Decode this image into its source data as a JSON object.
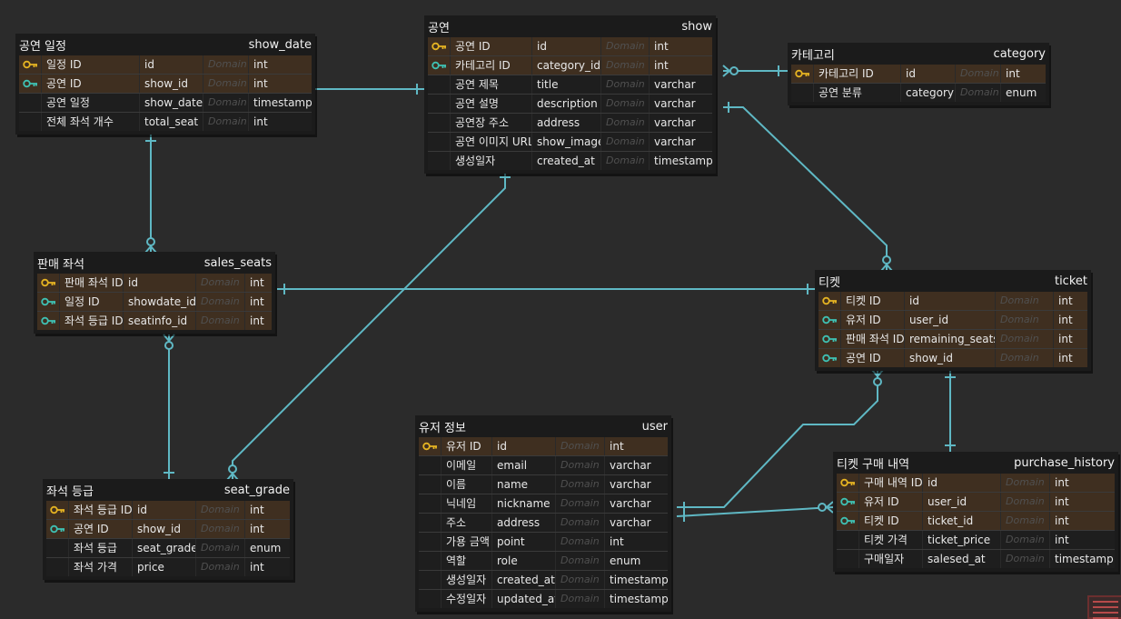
{
  "tables": {
    "show_date": {
      "title_ko": "공연 일정",
      "title_en": "show_date",
      "rows": [
        {
          "key": "pk",
          "label": "일정 ID",
          "col": "id",
          "domain": "Domain",
          "type": "int"
        },
        {
          "key": "fk",
          "label": "공연 ID",
          "col": "show_id",
          "domain": "Domain",
          "type": "int"
        },
        {
          "key": "",
          "label": "공연 일정",
          "col": "show_date",
          "domain": "Domain",
          "type": "timestamp"
        },
        {
          "key": "",
          "label": "전체 좌석 개수",
          "col": "total_seat",
          "domain": "Domain",
          "type": "int"
        }
      ]
    },
    "show": {
      "title_ko": "공연",
      "title_en": "show",
      "rows": [
        {
          "key": "pk",
          "label": "공연 ID",
          "col": "id",
          "domain": "Domain",
          "type": "int"
        },
        {
          "key": "fk",
          "label": "카테고리 ID",
          "col": "category_id",
          "domain": "Domain",
          "type": "int"
        },
        {
          "key": "",
          "label": "공연 제목",
          "col": "title",
          "domain": "Domain",
          "type": "varchar"
        },
        {
          "key": "",
          "label": "공연 설명",
          "col": "description",
          "domain": "Domain",
          "type": "varchar"
        },
        {
          "key": "",
          "label": "공연장 주소",
          "col": "address",
          "domain": "Domain",
          "type": "varchar"
        },
        {
          "key": "",
          "label": "공연 이미지 URL",
          "col": "show_image",
          "domain": "Domain",
          "type": "varchar"
        },
        {
          "key": "",
          "label": "생성일자",
          "col": "created_at",
          "domain": "Domain",
          "type": "timestamp"
        }
      ]
    },
    "category": {
      "title_ko": "카테고리",
      "title_en": "category",
      "rows": [
        {
          "key": "pk",
          "label": "카테고리 ID",
          "col": "id",
          "domain": "Domain",
          "type": "int"
        },
        {
          "key": "",
          "label": "공연 분류",
          "col": "category",
          "domain": "Domain",
          "type": "enum"
        }
      ]
    },
    "sales_seats": {
      "title_ko": "판매 좌석",
      "title_en": "sales_seats",
      "rows": [
        {
          "key": "pk",
          "label": "판매 좌석 ID",
          "col": "id",
          "domain": "Domain",
          "type": "int"
        },
        {
          "key": "fk",
          "label": "일정 ID",
          "col": "showdate_id",
          "domain": "Domain",
          "type": "int"
        },
        {
          "key": "fk",
          "label": "좌석 등급 ID",
          "col": "seatinfo_id",
          "domain": "Domain",
          "type": "int"
        }
      ]
    },
    "ticket": {
      "title_ko": "티켓",
      "title_en": "ticket",
      "rows": [
        {
          "key": "pk",
          "label": "티켓 ID",
          "col": "id",
          "domain": "Domain",
          "type": "int"
        },
        {
          "key": "fk",
          "label": "유저 ID",
          "col": "user_id",
          "domain": "Domain",
          "type": "int"
        },
        {
          "key": "fk",
          "label": "판매 좌석 ID",
          "col": "remaining_seats_id",
          "domain": "Domain",
          "type": "int"
        },
        {
          "key": "fk",
          "label": "공연 ID",
          "col": "show_id",
          "domain": "Domain",
          "type": "int"
        }
      ]
    },
    "user": {
      "title_ko": "유저 정보",
      "title_en": "user",
      "rows": [
        {
          "key": "pk",
          "label": "유저 ID",
          "col": "id",
          "domain": "Domain",
          "type": "int"
        },
        {
          "key": "",
          "label": "이메일",
          "col": "email",
          "domain": "Domain",
          "type": "varchar"
        },
        {
          "key": "",
          "label": "이름",
          "col": "name",
          "domain": "Domain",
          "type": "varchar"
        },
        {
          "key": "",
          "label": "닉네임",
          "col": "nickname",
          "domain": "Domain",
          "type": "varchar"
        },
        {
          "key": "",
          "label": "주소",
          "col": "address",
          "domain": "Domain",
          "type": "varchar"
        },
        {
          "key": "",
          "label": "가용 금액",
          "col": "point",
          "domain": "Domain",
          "type": "int"
        },
        {
          "key": "",
          "label": "역할",
          "col": "role",
          "domain": "Domain",
          "type": "enum"
        },
        {
          "key": "",
          "label": "생성일자",
          "col": "created_at",
          "domain": "Domain",
          "type": "timestamp"
        },
        {
          "key": "",
          "label": "수정일자",
          "col": "updated_at",
          "domain": "Domain",
          "type": "timestamp"
        }
      ]
    },
    "seat_grade": {
      "title_ko": "좌석 등급",
      "title_en": "seat_grade",
      "rows": [
        {
          "key": "pk",
          "label": "좌석 등급 ID",
          "col": "id",
          "domain": "Domain",
          "type": "int"
        },
        {
          "key": "fk",
          "label": "공연 ID",
          "col": "show_id",
          "domain": "Domain",
          "type": "int"
        },
        {
          "key": "",
          "label": "좌석 등급",
          "col": "seat_grade",
          "domain": "Domain",
          "type": "enum"
        },
        {
          "key": "",
          "label": "좌석 가격",
          "col": "price",
          "domain": "Domain",
          "type": "int"
        }
      ]
    },
    "purchase_history": {
      "title_ko": "티켓 구매 내역",
      "title_en": "purchase_history",
      "rows": [
        {
          "key": "pk",
          "label": "구매 내역 ID",
          "col": "id",
          "domain": "Domain",
          "type": "int"
        },
        {
          "key": "fk",
          "label": "유저 ID",
          "col": "user_id",
          "domain": "Domain",
          "type": "int"
        },
        {
          "key": "fk",
          "label": "티켓 ID",
          "col": "ticket_id",
          "domain": "Domain",
          "type": "int"
        },
        {
          "key": "",
          "label": "티켓 가격",
          "col": "ticket_price",
          "domain": "Domain",
          "type": "int"
        },
        {
          "key": "",
          "label": "구매일자",
          "col": "salesed_at",
          "domain": "Domain",
          "type": "timestamp"
        }
      ]
    }
  },
  "colors": {
    "connector": "#5fb8c4",
    "primary_key_icon": "#e6b422",
    "foreign_key_icon": "#3fc2b4",
    "key_row_bg": "#3f2f20",
    "minimap_border": "#6b2f2f"
  }
}
